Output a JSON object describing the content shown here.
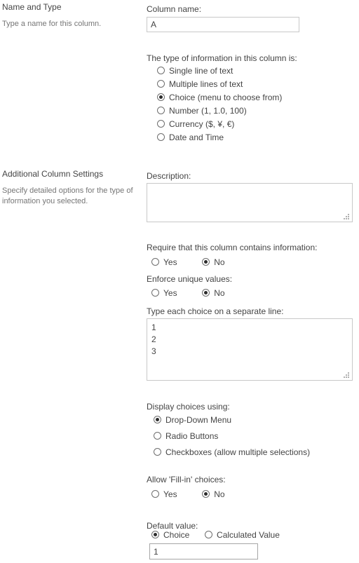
{
  "sections": [
    {
      "heading": "Name and Type",
      "sub": "Type a name for this column."
    },
    {
      "heading": "Additional Column Settings",
      "sub": "Specify detailed options for the type of information you selected."
    }
  ],
  "column_name": {
    "label": "Column name:",
    "value": "A",
    "placeholder": ""
  },
  "type_of_information": {
    "label": "The type of information in this column is:",
    "selected": "Choice (menu to choose from)",
    "options": [
      "Single line of text",
      "Multiple lines of text",
      "Choice (menu to choose from)",
      "Number (1, 1.0, 100)",
      "Currency ($, ¥, €)",
      "Date and Time"
    ]
  },
  "description": {
    "label": "Description:",
    "value": "",
    "placeholder": ""
  },
  "require_information": {
    "label": "Require that this column contains information:",
    "selected": "No",
    "options": [
      "Yes",
      "No"
    ]
  },
  "enforce_unique": {
    "label": "Enforce unique values:",
    "selected": "No",
    "options": [
      "Yes",
      "No"
    ]
  },
  "choices": {
    "label": "Type each choice on a separate line:",
    "value": "1\n2\n3",
    "lines": [
      "1",
      "2",
      "3"
    ]
  },
  "display_choices": {
    "label": "Display choices using:",
    "selected": "Drop-Down Menu",
    "options": [
      "Drop-Down Menu",
      "Radio Buttons",
      "Checkboxes (allow multiple selections)"
    ]
  },
  "fill_in_choices": {
    "label": "Allow 'Fill-in' choices:",
    "selected": "No",
    "options": [
      "Yes",
      "No"
    ]
  },
  "default_value": {
    "label": "Default value:",
    "selected": "Choice",
    "options": [
      "Choice",
      "Calculated Value"
    ],
    "value": "1",
    "placeholder": ""
  }
}
